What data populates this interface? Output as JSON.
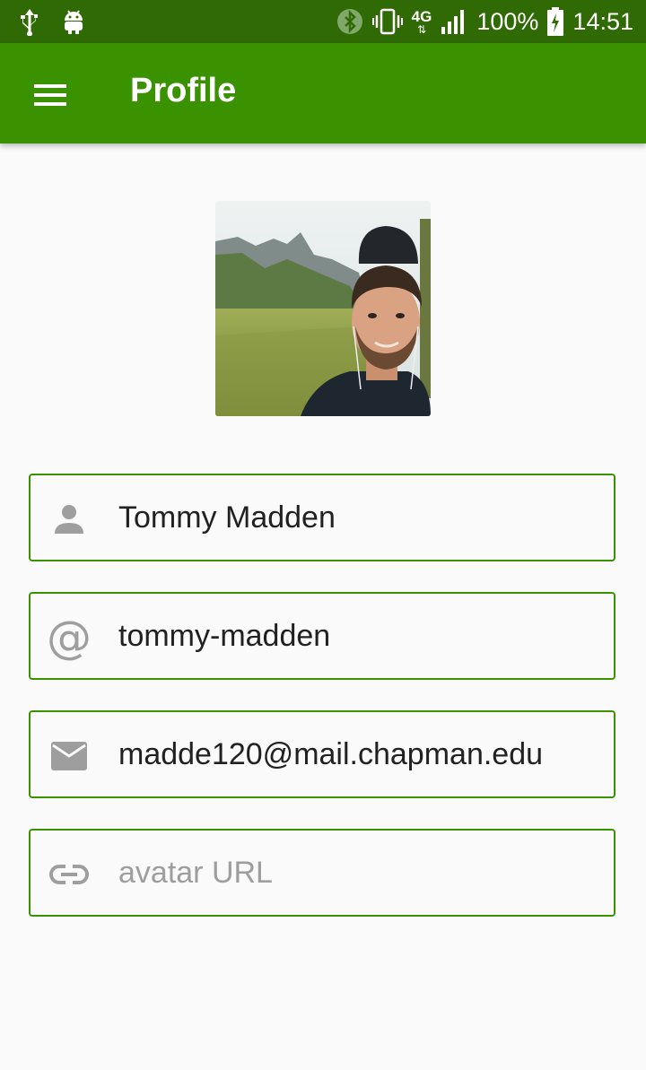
{
  "status_bar": {
    "battery": "100%",
    "time": "14:51",
    "network": "4G"
  },
  "toolbar": {
    "title": "Profile",
    "menu_icon": "hamburger-icon"
  },
  "profile": {
    "avatar_icon": "profile-photo"
  },
  "fields": {
    "name": {
      "value": "Tommy Madden",
      "icon": "person-icon"
    },
    "username": {
      "value": "tommy-madden",
      "icon": "at-icon"
    },
    "email": {
      "value": "madde120@mail.chapman.edu",
      "icon": "mail-icon"
    },
    "avatar_url": {
      "value": "",
      "placeholder": "avatar URL",
      "icon": "link-icon"
    }
  },
  "colors": {
    "status_bar": "#2f6a04",
    "toolbar": "#3b9200",
    "field_border": "#3b9200",
    "icon_gray": "#9e9e9e"
  }
}
